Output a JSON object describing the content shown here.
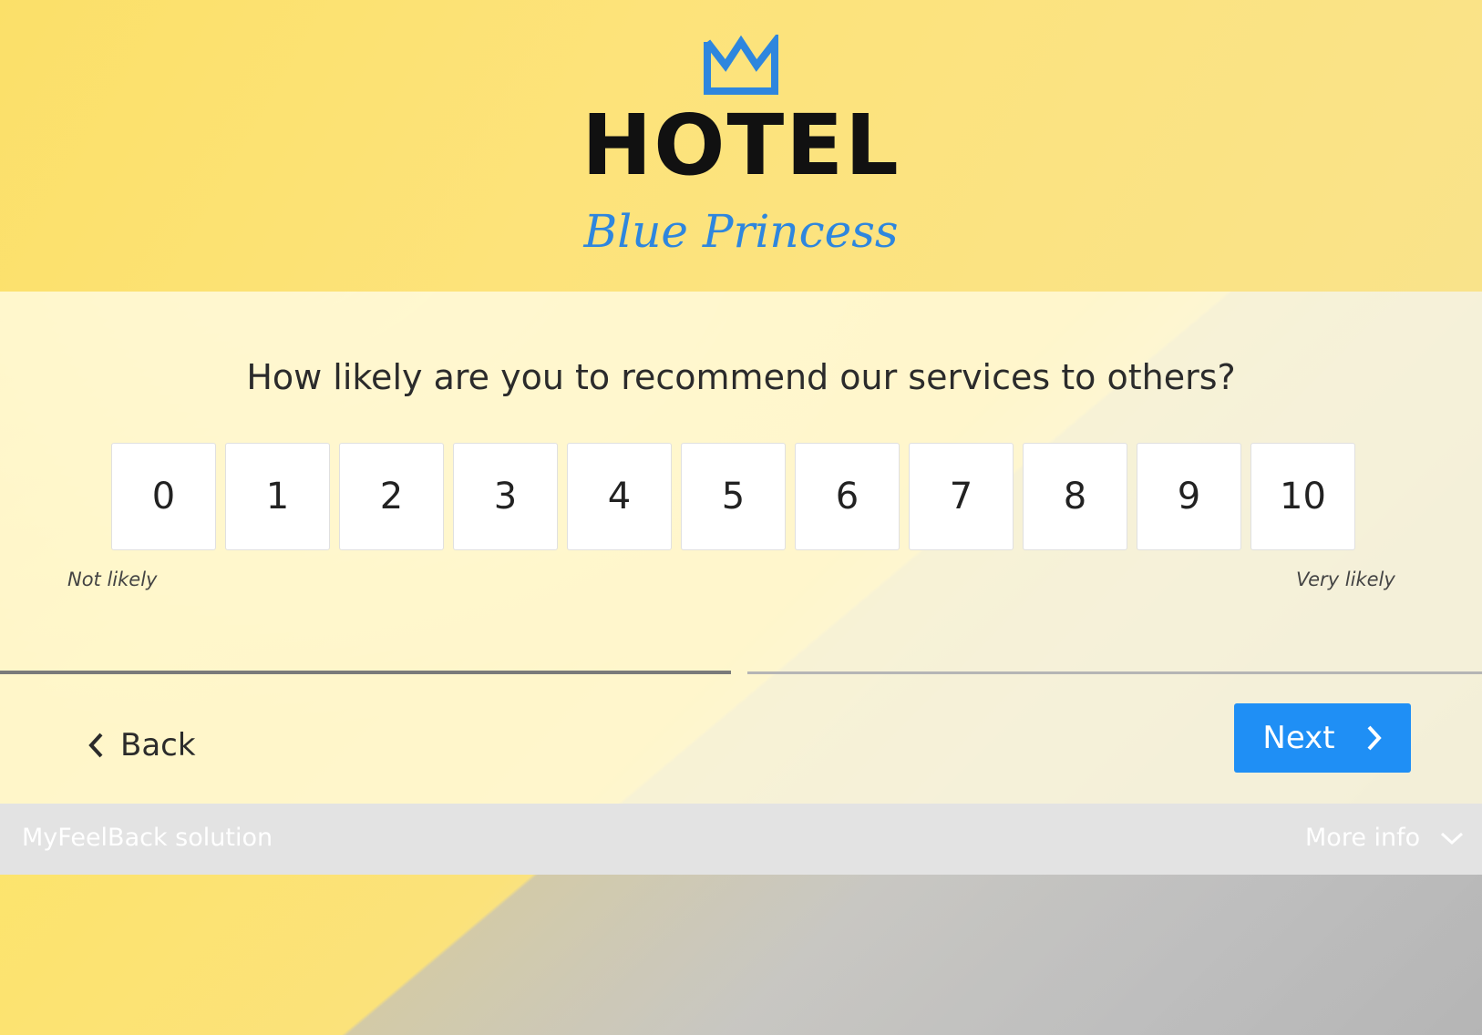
{
  "logo": {
    "icon": "crown-icon",
    "title": "HOTEL",
    "subtitle": "Blue Princess",
    "colors": {
      "title": "#111111",
      "accent": "#2e86de"
    }
  },
  "survey": {
    "question": "How likely are you to recommend our services to others?",
    "scale": [
      "0",
      "1",
      "2",
      "3",
      "4",
      "5",
      "6",
      "7",
      "8",
      "9",
      "10"
    ],
    "label_low": "Not likely",
    "label_high": "Very likely",
    "progress_fraction": 0.5
  },
  "nav": {
    "back_label": "Back",
    "back_icon": "chevron-left-icon",
    "next_label": "Next",
    "next_icon": "chevron-right-icon",
    "next_color": "#1f8ff5"
  },
  "footer": {
    "brand": "MyFeelBack solution",
    "more_info": "More info",
    "more_info_icon": "chevron-down-icon"
  }
}
